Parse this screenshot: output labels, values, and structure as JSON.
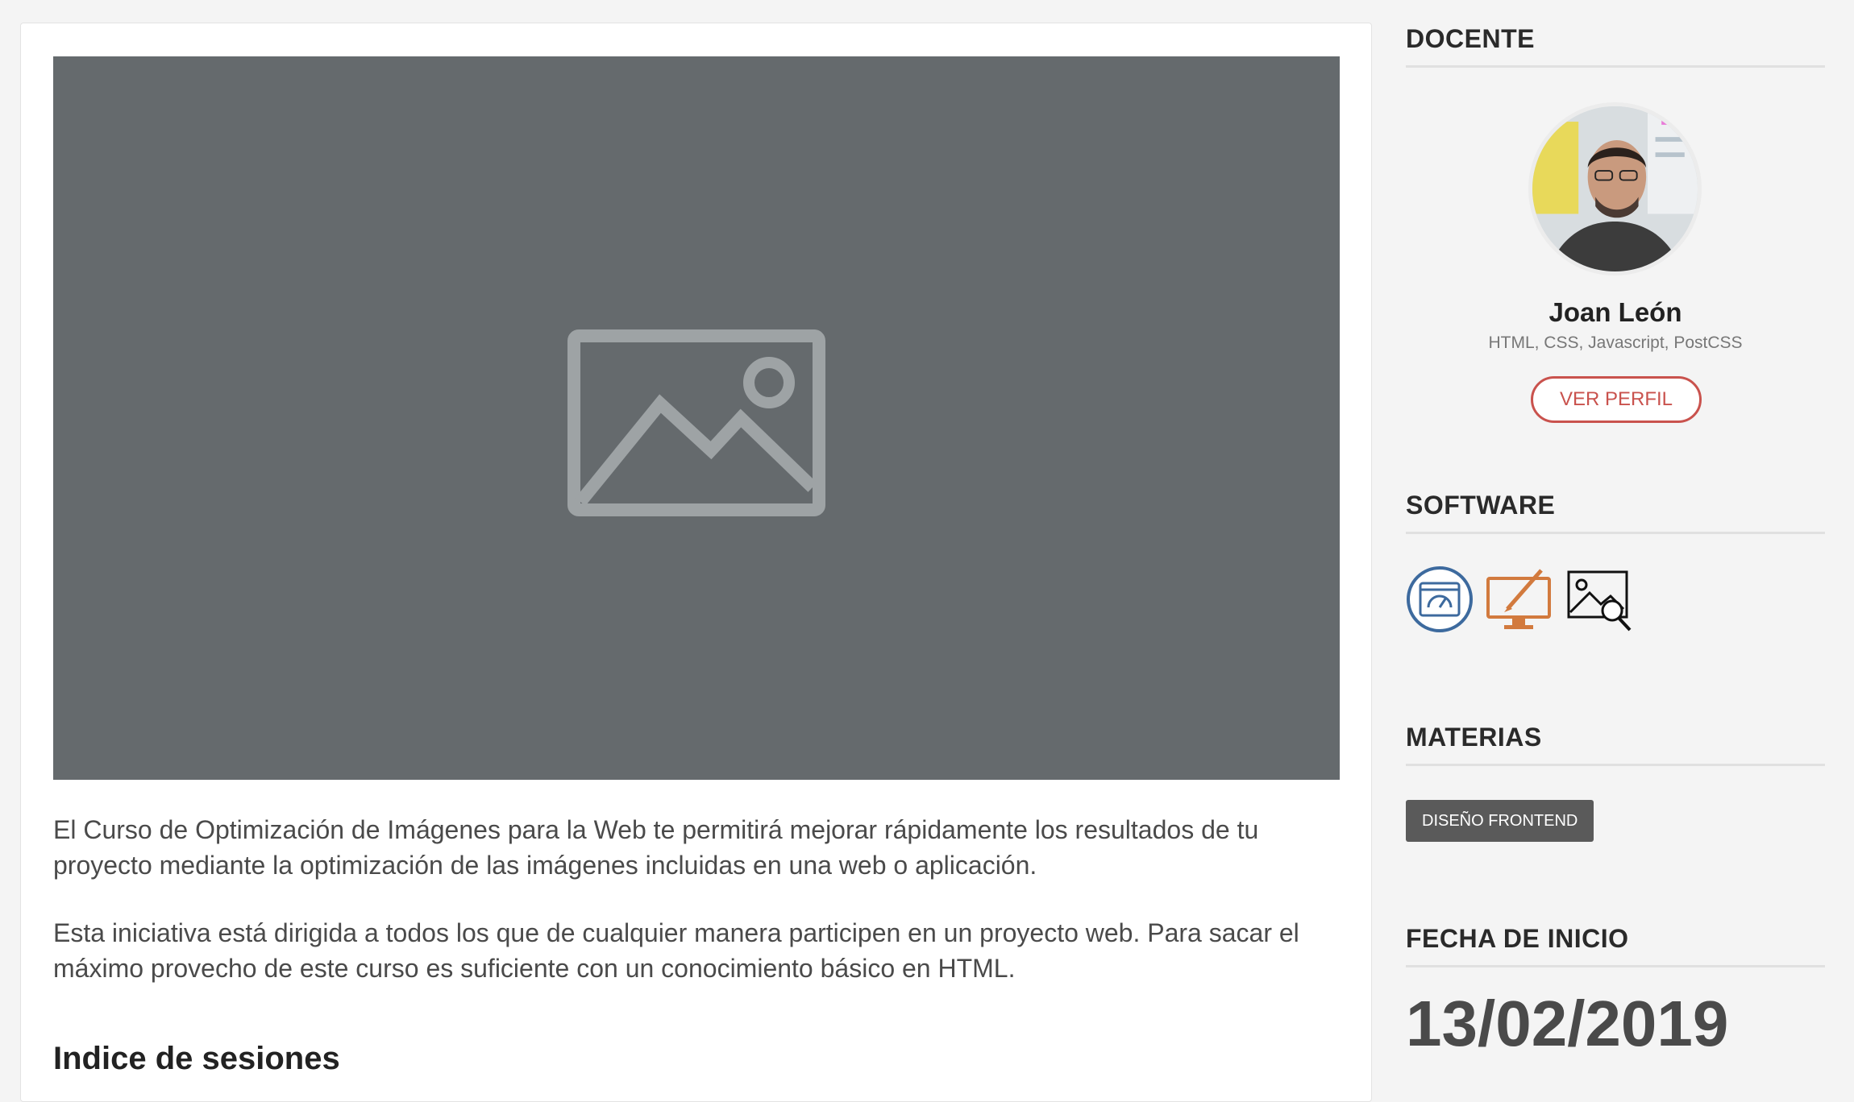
{
  "description": [
    "El Curso de Optimización de Imágenes para la Web te permitirá mejorar rápidamente los resultados de tu proyecto mediante la optimización de las imágenes incluidas en una web o aplicación.",
    "Esta iniciativa está dirigida a todos los que de cualquier manera participen en un proyecto web. Para sacar el máximo provecho de este curso es suficiente con un conocimiento básico en HTML."
  ],
  "sessions_title": "Indice de sesiones",
  "sidebar": {
    "teacher_title": "DOCENTE",
    "teacher_name": "Joan León",
    "teacher_skills": "HTML, CSS, Javascript, PostCSS",
    "profile_button": "VER PERFIL",
    "software_title": "SOFTWARE",
    "software_icons": [
      "pagespeed-icon",
      "design-monitor-icon",
      "image-search-icon"
    ],
    "subjects_title": "MATERIAS",
    "subject_tag": "DISEÑO FRONTEND",
    "start_title": "FECHA DE INICIO",
    "start_date": "13/02/2019"
  },
  "colors": {
    "accent": "#c9524d",
    "video_bg": "#656a6d",
    "tag_bg": "#5a5a5a"
  }
}
